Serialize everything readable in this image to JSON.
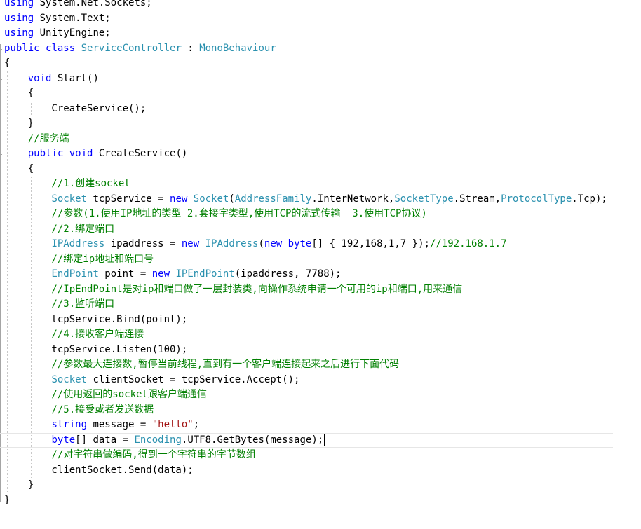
{
  "editor": {
    "colors": {
      "keyword": "#0000ff",
      "type": "#2b91af",
      "string": "#a31515",
      "comment": "#008000",
      "text": "#000000"
    },
    "lines": [
      [
        {
          "t": "using",
          "c": "kw"
        },
        {
          "t": " System.Net.Sockets;",
          "c": "plain"
        }
      ],
      [
        {
          "t": "using",
          "c": "kw"
        },
        {
          "t": " System.Text;",
          "c": "plain"
        }
      ],
      [
        {
          "t": "using",
          "c": "kw"
        },
        {
          "t": " UnityEngine;",
          "c": "plain"
        }
      ],
      [
        {
          "t": "public",
          "c": "kw"
        },
        {
          "t": " ",
          "c": "plain"
        },
        {
          "t": "class",
          "c": "kw"
        },
        {
          "t": " ",
          "c": "plain"
        },
        {
          "t": "ServiceController",
          "c": "type"
        },
        {
          "t": " : ",
          "c": "plain"
        },
        {
          "t": "MonoBehaviour",
          "c": "type"
        }
      ],
      [
        {
          "t": "{",
          "c": "plain"
        }
      ],
      [
        {
          "t": "    ",
          "c": "plain"
        },
        {
          "t": "void",
          "c": "kw"
        },
        {
          "t": " Start()",
          "c": "plain"
        }
      ],
      [
        {
          "t": "    {",
          "c": "plain"
        }
      ],
      [
        {
          "t": "        CreateService();",
          "c": "plain"
        }
      ],
      [
        {
          "t": "    }",
          "c": "plain"
        }
      ],
      [
        {
          "t": "    //服务端",
          "c": "cmt"
        }
      ],
      [
        {
          "t": "    ",
          "c": "plain"
        },
        {
          "t": "public",
          "c": "kw"
        },
        {
          "t": " ",
          "c": "plain"
        },
        {
          "t": "void",
          "c": "kw"
        },
        {
          "t": " CreateService()",
          "c": "plain"
        }
      ],
      [
        {
          "t": "    {",
          "c": "plain"
        }
      ],
      [
        {
          "t": "        //1.创建socket",
          "c": "cmt"
        }
      ],
      [
        {
          "t": "        ",
          "c": "plain"
        },
        {
          "t": "Socket",
          "c": "type"
        },
        {
          "t": " tcpService = ",
          "c": "plain"
        },
        {
          "t": "new",
          "c": "kw"
        },
        {
          "t": " ",
          "c": "plain"
        },
        {
          "t": "Socket",
          "c": "type"
        },
        {
          "t": "(",
          "c": "plain"
        },
        {
          "t": "AddressFamily",
          "c": "type"
        },
        {
          "t": ".InterNetwork,",
          "c": "plain"
        },
        {
          "t": "SocketType",
          "c": "type"
        },
        {
          "t": ".Stream,",
          "c": "plain"
        },
        {
          "t": "ProtocolType",
          "c": "type"
        },
        {
          "t": ".Tcp);",
          "c": "plain"
        }
      ],
      [
        {
          "t": "        //参数(1.使用IP地址的类型 2.套接字类型,使用TCP的流式传输  3.使用TCP协议)",
          "c": "cmt"
        }
      ],
      [
        {
          "t": "        //2.绑定端口",
          "c": "cmt"
        }
      ],
      [
        {
          "t": "        ",
          "c": "plain"
        },
        {
          "t": "IPAddress",
          "c": "type"
        },
        {
          "t": " ipaddress = ",
          "c": "plain"
        },
        {
          "t": "new",
          "c": "kw"
        },
        {
          "t": " ",
          "c": "plain"
        },
        {
          "t": "IPAddress",
          "c": "type"
        },
        {
          "t": "(",
          "c": "plain"
        },
        {
          "t": "new",
          "c": "kw"
        },
        {
          "t": " ",
          "c": "plain"
        },
        {
          "t": "byte",
          "c": "kw"
        },
        {
          "t": "[] { 192,168,1,7 });",
          "c": "plain"
        },
        {
          "t": "//192.168.1.7",
          "c": "cmt"
        }
      ],
      [
        {
          "t": "        //绑定ip地址和端口号",
          "c": "cmt"
        }
      ],
      [
        {
          "t": "        ",
          "c": "plain"
        },
        {
          "t": "EndPoint",
          "c": "type"
        },
        {
          "t": " point = ",
          "c": "plain"
        },
        {
          "t": "new",
          "c": "kw"
        },
        {
          "t": " ",
          "c": "plain"
        },
        {
          "t": "IPEndPoint",
          "c": "type"
        },
        {
          "t": "(ipaddress, 7788);",
          "c": "plain"
        }
      ],
      [
        {
          "t": "        //IpEndPoint是对ip和端口做了一层封装类,向操作系统申请一个可用的ip和端口,用来通信",
          "c": "cmt"
        }
      ],
      [
        {
          "t": "        //3.监听端口",
          "c": "cmt"
        }
      ],
      [
        {
          "t": "        tcpService.Bind(point);",
          "c": "plain"
        }
      ],
      [
        {
          "t": "        //4.接收客户端连接",
          "c": "cmt"
        }
      ],
      [
        {
          "t": "        tcpService.Listen(100);",
          "c": "plain"
        }
      ],
      [
        {
          "t": "        //参数最大连接数,暂停当前线程,直到有一个客户端连接起来之后进行下面代码",
          "c": "cmt"
        }
      ],
      [
        {
          "t": "        ",
          "c": "plain"
        },
        {
          "t": "Socket",
          "c": "type"
        },
        {
          "t": " clientSocket = tcpService.Accept();",
          "c": "plain"
        }
      ],
      [
        {
          "t": "        //使用返回的socket跟客户端通信",
          "c": "cmt"
        }
      ],
      [
        {
          "t": "        //5.接受或者发送数据",
          "c": "cmt"
        }
      ],
      [
        {
          "t": "        ",
          "c": "plain"
        },
        {
          "t": "string",
          "c": "kw"
        },
        {
          "t": " message = ",
          "c": "plain"
        },
        {
          "t": "\"hello\"",
          "c": "str"
        },
        {
          "t": ";",
          "c": "plain"
        }
      ],
      [
        {
          "t": "        ",
          "c": "plain"
        },
        {
          "t": "byte",
          "c": "kw"
        },
        {
          "t": "[] data = ",
          "c": "plain"
        },
        {
          "t": "Encoding",
          "c": "type"
        },
        {
          "t": ".UTF8.GetBytes(message);",
          "c": "plain"
        }
      ],
      [
        {
          "t": "        //对字符串做编码,得到一个字符串的字节数组",
          "c": "cmt"
        }
      ],
      [
        {
          "t": "        clientSocket.Send(data);",
          "c": "plain"
        }
      ],
      [
        {
          "t": "    }",
          "c": "plain"
        }
      ],
      [
        {
          "t": "}",
          "c": "plain"
        }
      ]
    ],
    "current_line": 29
  }
}
